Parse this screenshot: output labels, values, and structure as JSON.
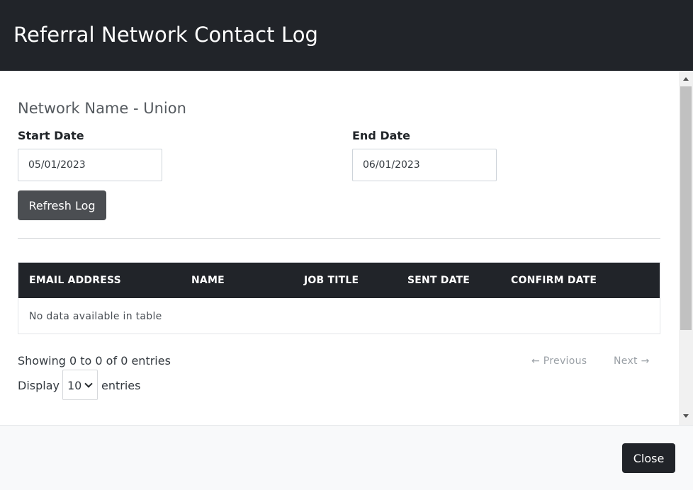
{
  "modal": {
    "title": "Referral Network Contact Log"
  },
  "form": {
    "network_name": "Network Name - Union",
    "start_date_label": "Start Date",
    "start_date_value": "05/01/2023",
    "end_date_label": "End Date",
    "end_date_value": "06/01/2023",
    "refresh_label": "Refresh Log"
  },
  "table": {
    "columns": [
      "EMAIL ADDRESS",
      "NAME",
      "JOB TITLE",
      "SENT DATE",
      "CONFIRM DATE"
    ],
    "rows": [],
    "empty_message": "No data available in table"
  },
  "pagination": {
    "info": "Showing 0 to 0 of 0 entries",
    "previous_label": "← Previous",
    "next_label": "Next →",
    "display_label": "Display",
    "entries_label": "entries",
    "page_length": "10"
  },
  "footer": {
    "close_label": "Close"
  },
  "colors": {
    "header_bg": "#212429",
    "secondary_button": "#4b4e52",
    "footer_bg": "#f8f9fa"
  }
}
